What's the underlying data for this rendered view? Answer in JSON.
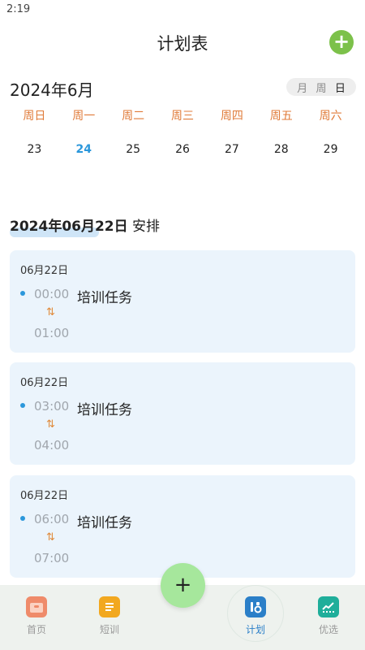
{
  "status_bar": {
    "time": "2:19"
  },
  "header": {
    "title": "计划表",
    "add_icon": "plus-circle-icon",
    "accent": "#7cc14a"
  },
  "calendar": {
    "month_label": "2024年6月",
    "view_options": [
      {
        "label": "月",
        "active": false
      },
      {
        "label": "周",
        "active": false
      },
      {
        "label": "日",
        "active": true
      }
    ],
    "weekdays": [
      "周日",
      "周一",
      "周二",
      "周三",
      "周四",
      "周五",
      "周六"
    ],
    "dates": [
      "23",
      "24",
      "25",
      "26",
      "27",
      "28",
      "29"
    ],
    "today": "24"
  },
  "schedule": {
    "heading_date": "2024年06月22日",
    "heading_suffix": "安排",
    "items": [
      {
        "date": "06月22日",
        "start": "00:00",
        "end": "01:00",
        "title": "培训任务"
      },
      {
        "date": "06月22日",
        "start": "03:00",
        "end": "04:00",
        "title": "培训任务"
      },
      {
        "date": "06月22日",
        "start": "06:00",
        "end": "07:00",
        "title": "培训任务"
      }
    ]
  },
  "bottom_nav": {
    "items": [
      {
        "label": "首页",
        "icon": "home-icon",
        "active": false
      },
      {
        "label": "短训",
        "icon": "document-icon",
        "active": false
      },
      {
        "label": "计划",
        "icon": "plan-tools-icon",
        "active": true
      },
      {
        "label": "优选",
        "icon": "chart-icon",
        "active": false
      }
    ]
  },
  "fab": {
    "symbol": "+"
  },
  "colors": {
    "weekday": "#e07b39",
    "today": "#2b97db",
    "card_bg": "#ebf4fc",
    "time_gray": "#a0a6ad"
  }
}
